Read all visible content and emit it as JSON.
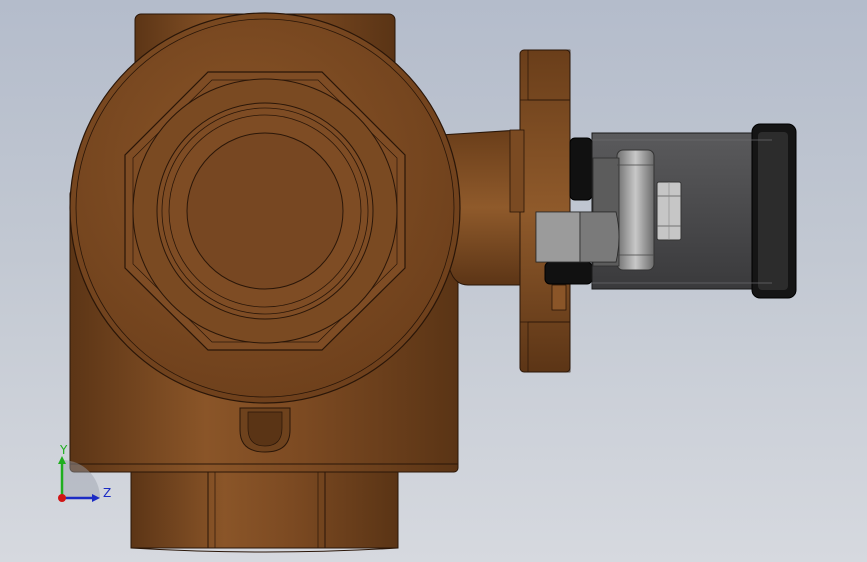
{
  "viewport": {
    "background_top": "#b4bccb",
    "background_bottom": "#d6d9df"
  },
  "model": {
    "body_color": "#7a4a22",
    "body_highlight": "#a46a3a",
    "actuator_color": "#4c4c4e",
    "gear_color": "#9a9a9a",
    "seal_color": "#101010"
  },
  "triad": {
    "y_label": "Y",
    "z_label": "Z",
    "y_color": "#1fae1f",
    "z_color": "#1b2bc4",
    "x_color": "#d01515"
  }
}
